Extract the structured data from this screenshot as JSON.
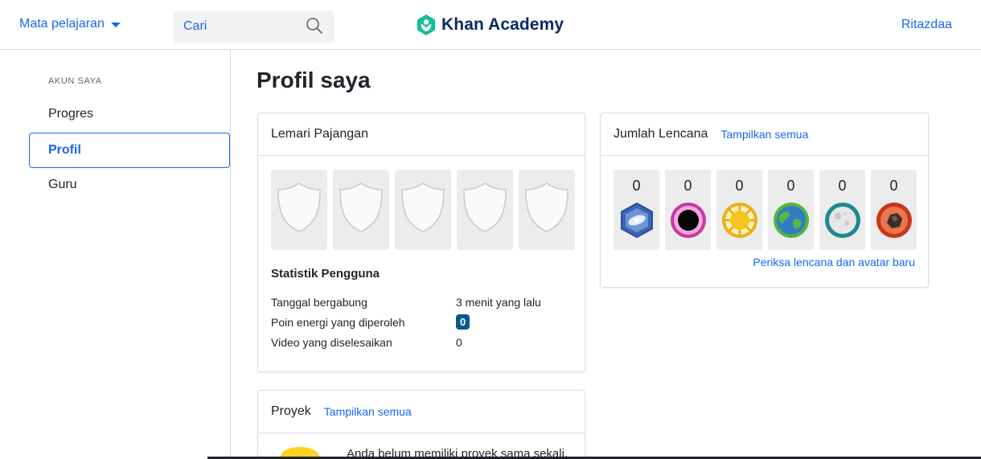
{
  "header": {
    "subjects_label": "Mata pelajaran",
    "search_placeholder": "Cari",
    "logo_text": "Khan Academy",
    "username": "Ritazdaa"
  },
  "sidebar": {
    "heading": "AKUN SAYA",
    "items": [
      {
        "label": "Progres"
      },
      {
        "label": "Profil"
      },
      {
        "label": "Guru"
      }
    ]
  },
  "main": {
    "title": "Profil saya",
    "showcase": {
      "title": "Lemari Pajangan"
    },
    "stats": {
      "title": "Statistik Pengguna",
      "rows": [
        {
          "label": "Tanggal bergabung",
          "value": "3 menit yang lalu"
        },
        {
          "label": "Poin energi yang diperoleh",
          "value": "0"
        },
        {
          "label": "Video yang diselesaikan",
          "value": "0"
        }
      ]
    },
    "badges": {
      "title": "Jumlah Lencana",
      "show_all": "Tampilkan semua",
      "counts": [
        "0",
        "0",
        "0",
        "0",
        "0",
        "0"
      ],
      "icons": [
        "challenge-patch-icon",
        "black-hole-icon",
        "sun-icon",
        "earth-icon",
        "moon-icon",
        "meteorite-icon"
      ],
      "footer_link": "Periksa lencana dan avatar baru"
    },
    "projects": {
      "title": "Proyek",
      "show_all": "Tampilkan semua",
      "empty_text": "Anda belum memiliki proyek sama sekali."
    }
  },
  "colors": {
    "accent": "#1865f2",
    "logo_green": "#14bf96",
    "logo_navy": "#0a2a66",
    "energy_badge": "#0b5a86"
  }
}
